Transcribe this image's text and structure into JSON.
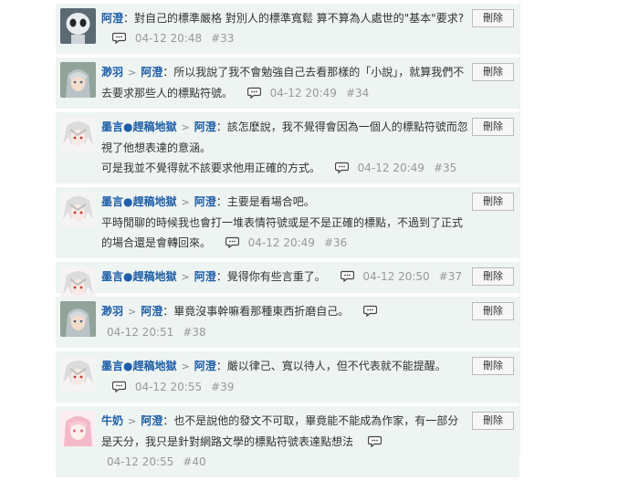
{
  "delete_label": "刪除",
  "arrow": ">",
  "comments": [
    {
      "id": 33,
      "avatar": "robot-avatar",
      "author": "",
      "reply_to": "阿澄",
      "text": "對自己的標準嚴格 對別人的標準寬鬆 算不算為人處世的\"基本\"要求?",
      "time": "04-12 20:48",
      "num": "#33"
    },
    {
      "id": 34,
      "avatar": "gray-hair-avatar",
      "author": "渺羽",
      "reply_to": "阿澄",
      "text": "所以我說了我不會勉強自己去看那樣的「小說」，就算我們不去要求那些人的標點符號。",
      "time": "04-12 20:49",
      "num": "#34"
    },
    {
      "id": 35,
      "avatar": "white-hair-avatar",
      "author": "墨言●趕稿地獄",
      "reply_to": "阿澄",
      "text": "該怎麽說，我不覺得會因為一個人的標點符號而忽視了他想表達的意涵。",
      "text2": "可是我並不覺得就不該要求他用正確的方式。",
      "time": "04-12 20:49",
      "num": "#35"
    },
    {
      "id": 36,
      "avatar": "white-hair-avatar",
      "author": "墨言●趕稿地獄",
      "reply_to": "阿澄",
      "text": "主要是看場合吧。",
      "text2": "平時閒聊的時候我也會打一堆表情符號或是不是正確的標點，不過到了正式的場合還是會轉回來。",
      "time": "04-12 20:49",
      "num": "#36"
    },
    {
      "id": 37,
      "avatar": "white-hair-avatar",
      "author": "墨言●趕稿地獄",
      "reply_to": "阿澄",
      "text": "覺得你有些言重了。",
      "time": "04-12 20:50",
      "num": "#37"
    },
    {
      "id": 38,
      "avatar": "gray-hair-avatar",
      "author": "渺羽",
      "reply_to": "阿澄",
      "text": "畢竟沒事幹嘛看那種東西折磨自己。",
      "time": "04-12 20:51",
      "num": "#38"
    },
    {
      "id": 39,
      "avatar": "white-hair-avatar",
      "author": "墨言●趕稿地獄",
      "reply_to": "阿澄",
      "text": "嚴以律己、寬以待人，但不代表就不能提醒。",
      "time": "04-12 20:55",
      "num": "#39"
    },
    {
      "id": 40,
      "avatar": "pink-hair-avatar",
      "author": "牛奶",
      "reply_to": "阿澄",
      "text": "也不是說他的發文不可取，畢竟能不能成為作家，有一部分是天分，我只是針對網路文學的標點符號表達點想法",
      "time": "04-12 20:55",
      "num": "#40"
    }
  ]
}
